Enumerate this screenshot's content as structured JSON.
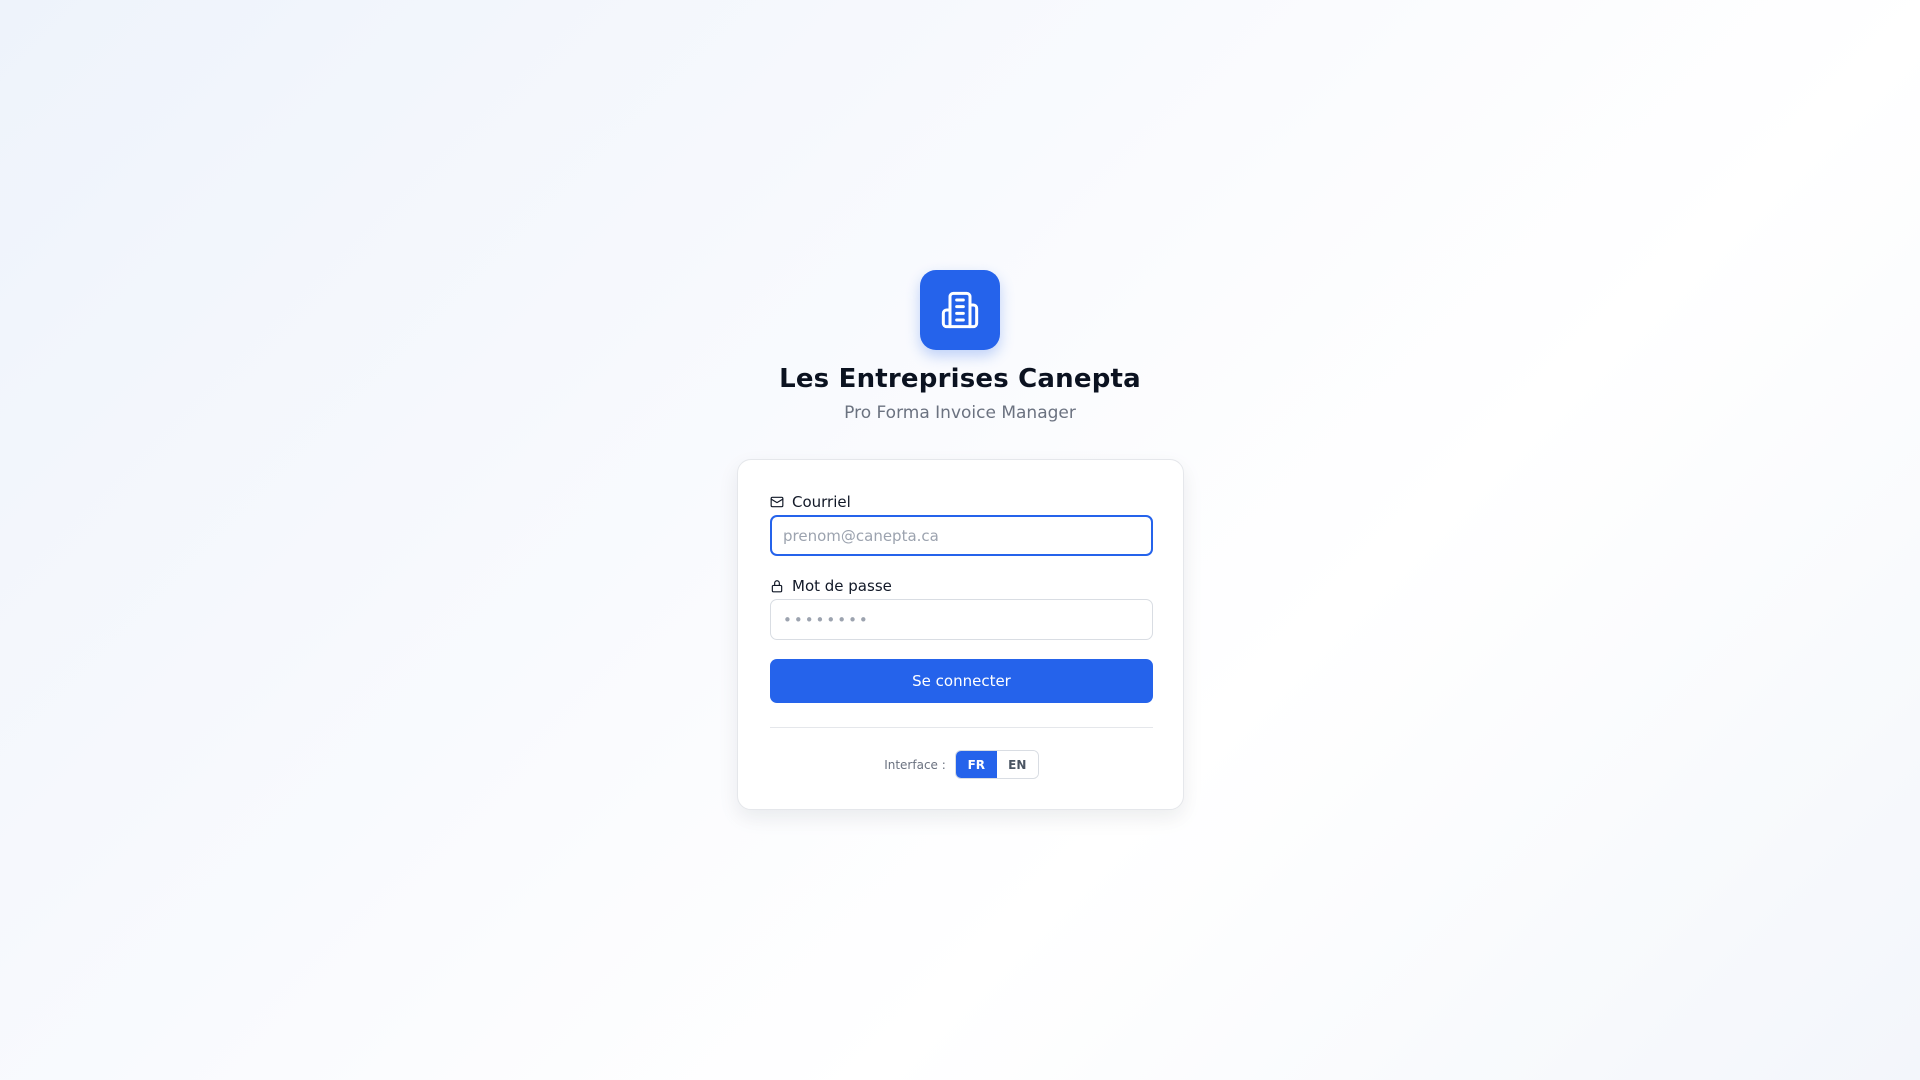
{
  "brand": {
    "name": "Les Entreprises Canepta",
    "subtitle": "Pro Forma Invoice Manager",
    "logo_icon": "building-icon",
    "accent_color": "#2563eb"
  },
  "login_form": {
    "email": {
      "label": "Courriel",
      "icon": "mail-icon",
      "placeholder": "prenom@canepta.ca",
      "value": ""
    },
    "password": {
      "label": "Mot de passe",
      "icon": "lock-icon",
      "placeholder": "••••••••",
      "value": ""
    },
    "submit_label": "Se connecter"
  },
  "language": {
    "label": "Interface :",
    "options": [
      "FR",
      "EN"
    ],
    "selected": "FR"
  }
}
